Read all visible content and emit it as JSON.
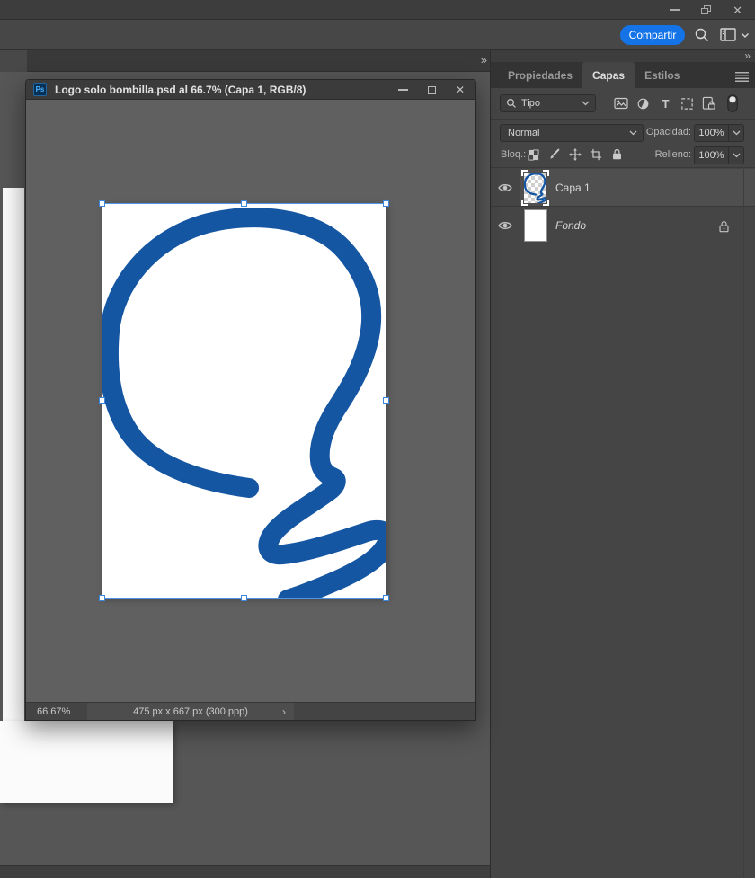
{
  "app_titlebar": {
    "close_glyph": "✕"
  },
  "options_bar": {
    "share_label": "Compartir"
  },
  "tab_strip": {
    "overflow_chevrons": "»"
  },
  "doc_window": {
    "icon_text": "Ps",
    "title": "Logo solo bombilla.psd al 66.7% (Capa 1, RGB/8)",
    "close_glyph": "✕",
    "canvas_description": "blue hand-drawn light bulb outline sketch",
    "status_bar": {
      "zoom": "66.67%",
      "info": "475 px x 667 px (300 ppp)",
      "chevron": "›"
    }
  },
  "dock": {
    "collapse_chevrons": "»",
    "tabs": {
      "properties": "Propiedades",
      "layers": "Capas",
      "styles": "Estilos"
    },
    "filter_row": {
      "kind_label": "Tipo"
    },
    "blend_row": {
      "mode": "Normal",
      "opacity_label": "Opacidad:",
      "opacity_value": "100%"
    },
    "lock_row": {
      "label": "Bloq.:",
      "fill_label": "Relleno:",
      "fill_value": "100%"
    },
    "layers": [
      {
        "name": "Capa 1",
        "selected": true
      },
      {
        "name": "Fondo",
        "selected": false,
        "locked": true
      }
    ]
  },
  "colors": {
    "accent_blue": "#1473e6",
    "bulb_blue": "#1556a3",
    "selection_blue": "#4f95e8",
    "ps_icon_blue": "#49b3ff"
  }
}
